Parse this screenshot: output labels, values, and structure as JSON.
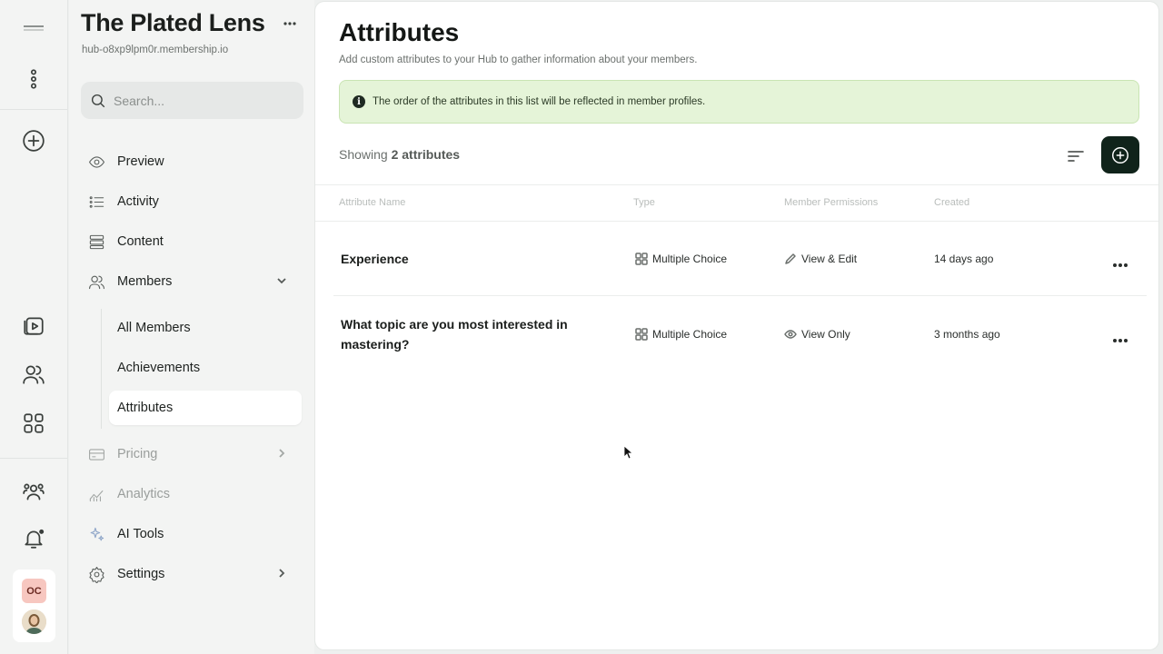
{
  "hub": {
    "title": "The Plated Lens",
    "url": "hub-o8xp9lpm0r.membership.io"
  },
  "search": {
    "placeholder": "Search..."
  },
  "nav": {
    "preview": "Preview",
    "activity": "Activity",
    "content": "Content",
    "members": "Members",
    "all_members": "All Members",
    "achievements": "Achievements",
    "attributes": "Attributes",
    "pricing": "Pricing",
    "analytics": "Analytics",
    "ai_tools": "AI Tools",
    "settings": "Settings"
  },
  "rail": {
    "avatar_initials": "OC"
  },
  "page": {
    "title": "Attributes",
    "subtitle": "Add custom attributes to your Hub to gather information about your members.",
    "notice": "The order of the attributes in this list will be reflected in member profiles.",
    "showing_prefix": "Showing ",
    "showing_count": "2 attributes"
  },
  "table": {
    "columns": [
      "Attribute Name",
      "Type",
      "Member Permissions",
      "Created"
    ],
    "rows": [
      {
        "name": "Experience",
        "type": "Multiple Choice",
        "permission": "View & Edit",
        "permission_icon": "pencil-icon",
        "created": "14 days ago"
      },
      {
        "name": "What topic are you most interested in mastering?",
        "type": "Multiple Choice",
        "permission": "View Only",
        "permission_icon": "eye-icon",
        "created": "3 months ago"
      }
    ]
  },
  "colors": {
    "accent": "#10231a",
    "notice_bg": "#e5f4d8",
    "avatar_bg": "#f7c7c0"
  }
}
